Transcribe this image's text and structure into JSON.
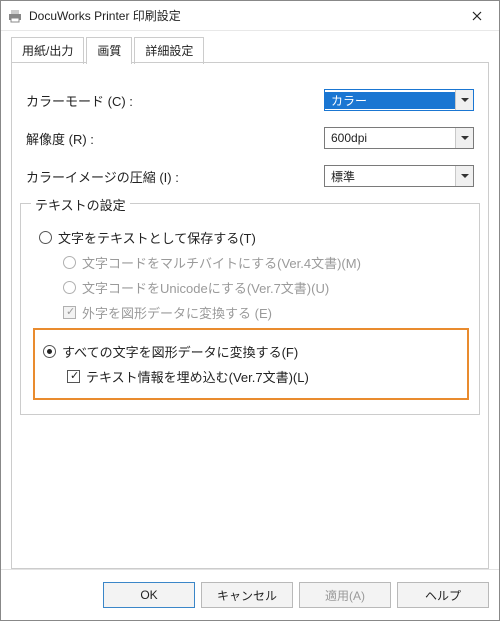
{
  "window": {
    "title": "DocuWorks Printer 印刷設定"
  },
  "tabs": [
    {
      "label": "用紙/出力",
      "active": false
    },
    {
      "label": "画質",
      "active": true
    },
    {
      "label": "詳細設定",
      "active": false
    }
  ],
  "fields": {
    "colorMode": {
      "label": "カラーモード (C) :",
      "value": "カラー"
    },
    "resolution": {
      "label": "解像度 (R) :",
      "value": "600dpi"
    },
    "colorImgComp": {
      "label": "カラーイメージの圧縮 (I) :",
      "value": "標準"
    }
  },
  "textSettings": {
    "legend": "テキストの設定",
    "saveAsText": {
      "label": "文字をテキストとして保存する(T)",
      "checked": false,
      "enabled": true
    },
    "multibyte": {
      "label": "文字コードをマルチバイトにする(Ver.4文書)(M)",
      "checked": false,
      "enabled": false
    },
    "unicode": {
      "label": "文字コードをUnicodeにする(Ver.7文書)(U)",
      "checked": false,
      "enabled": false
    },
    "gaijiToShape": {
      "label": "外字を図形データに変換する (E)",
      "checked": true,
      "enabled": false
    },
    "allToShape": {
      "label": "すべての文字を図形データに変換する(F)",
      "checked": true,
      "enabled": true
    },
    "embedTextInfo": {
      "label": "テキスト情報を埋め込む(Ver.7文書)(L)",
      "checked": true,
      "enabled": true
    }
  },
  "buttons": {
    "ok": "OK",
    "cancel": "キャンセル",
    "apply": "適用(A)",
    "help": "ヘルプ"
  }
}
